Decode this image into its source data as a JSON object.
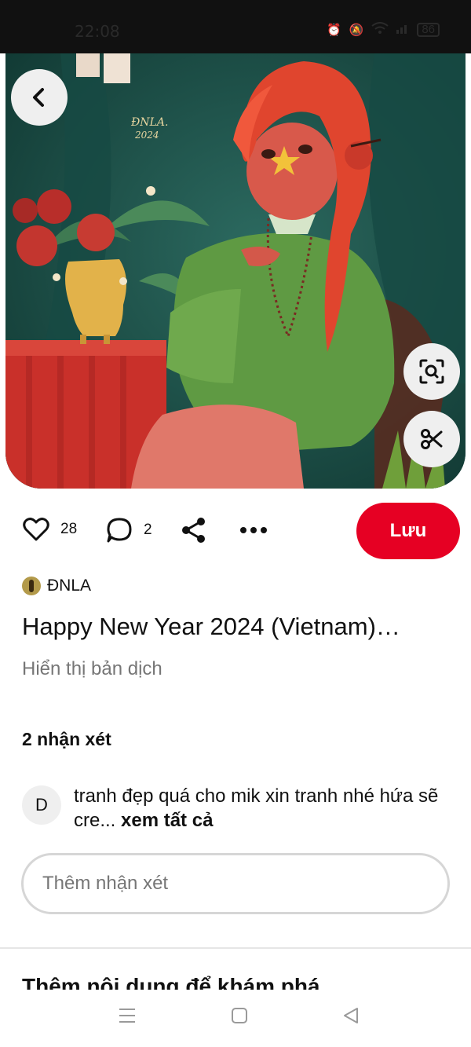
{
  "status_bar": {
    "time": "22:08",
    "battery": "86",
    "icons": [
      "alarm-icon",
      "mute-icon",
      "wifi-icon",
      "signal-icon",
      "battery-icon"
    ]
  },
  "image": {
    "signature": "ĐNLA.",
    "year": "2024"
  },
  "actions": {
    "like_count": "28",
    "comment_count": "2",
    "save_label": "Lưu"
  },
  "creator": {
    "name": "ĐNLA"
  },
  "pin": {
    "title": "Happy New Year 2024 (Vietnam)…",
    "translate_label": "Hiển thị bản dịch"
  },
  "comments": {
    "heading": "2 nhận xét",
    "items": [
      {
        "avatar_letter": "D",
        "text": "tranh đẹp quá cho mik xin tranh nhé hứa sẽ cre...",
        "more_label": "xem tất cả"
      }
    ],
    "add_placeholder": "Thêm nhận xét"
  },
  "more_section": {
    "heading": "Thêm nội dung để khám phá"
  },
  "colors": {
    "accent": "#e60023",
    "muted_text": "#767676",
    "button_bg": "#efefef"
  }
}
